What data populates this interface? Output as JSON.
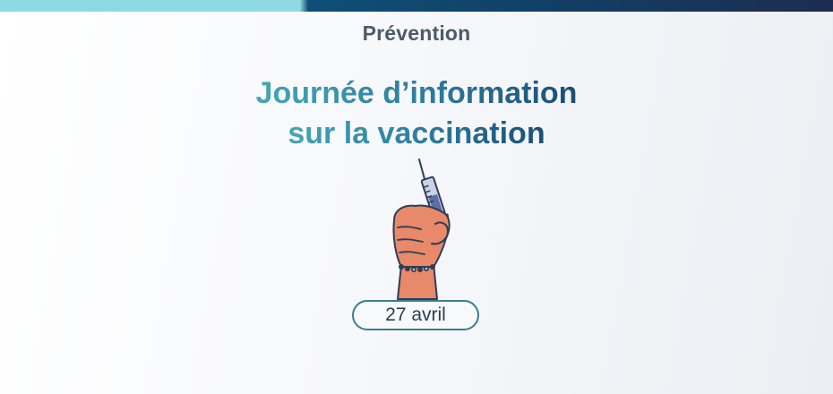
{
  "header": {
    "category": "Prévention",
    "title_line1": "Journée d’information",
    "title_line2": "sur la vaccination"
  },
  "event": {
    "date": "27 avril"
  },
  "illustration": {
    "icon": "hand-holding-syringe-icon"
  },
  "colors": {
    "accent_teal": "#43a8b6",
    "accent_navy": "#1b4e76",
    "top_bar_light": "#8fd9e2",
    "top_bar_dark": "#133d63",
    "skin": "#e8896a",
    "pill_border": "#3c7d8f"
  }
}
